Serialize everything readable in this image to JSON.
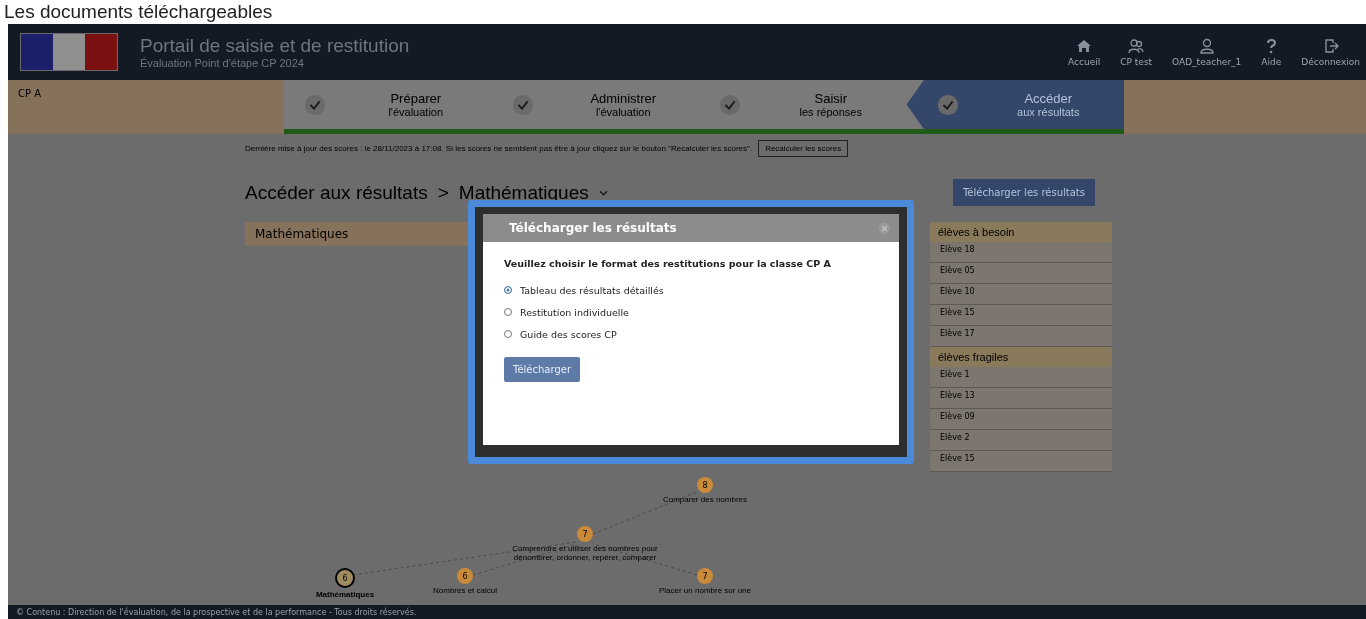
{
  "caption": "Les documents téléchargeables",
  "header": {
    "title": "Portail de saisie et de restitution",
    "subtitle": "Évaluation Point d'étape CP 2024",
    "nav": [
      {
        "label": "Accueil"
      },
      {
        "label": "CP test"
      },
      {
        "label": "OAD_teacher_1"
      },
      {
        "label": "Aide"
      },
      {
        "label": "Déconnexion"
      }
    ]
  },
  "class_name": "CP A",
  "steps": [
    {
      "title": "Préparer",
      "subtitle": "l'évaluation",
      "done": true,
      "selected": false
    },
    {
      "title": "Administrer",
      "subtitle": "l'évaluation",
      "done": true,
      "selected": false
    },
    {
      "title": "Saisir",
      "subtitle": "les réponses",
      "done": true,
      "selected": false
    },
    {
      "title": "Accéder",
      "subtitle": "aux résultats",
      "done": true,
      "selected": true
    }
  ],
  "update_notice": "Dernière mise à jour des scores : le 28/11/2023 à 17:08. Si les scores ne semblent pas être à jour cliquez sur le bouton \"Recalculer les scores\".",
  "recalc_button": "Recalculer les scores",
  "breadcrumb": {
    "root": "Accéder aux résultats",
    "separator": ">",
    "current": "Mathématiques"
  },
  "download_button": "Télécharger les résultats",
  "domain_panel": {
    "title": "Mathématiques",
    "nodes": [
      {
        "kind": "item",
        "score": "8",
        "label": "Comparer des nombres"
      },
      {
        "kind": "item",
        "score": "7",
        "label": "Comprendre et utiliser des nombres pour dénombrer, ordonner, repérer, comparer"
      },
      {
        "kind": "root",
        "score": "6",
        "label": "Mathématiques"
      },
      {
        "kind": "item",
        "score": "6",
        "label": "Nombres et calcul"
      },
      {
        "kind": "item",
        "score": "7",
        "label": "Placer un nombre sur une"
      }
    ]
  },
  "groups": [
    {
      "title": "élèves à besoin",
      "students": [
        "Elève 18",
        "Elève 05",
        "Elève 10",
        "Elève 15",
        "Elève 17"
      ]
    },
    {
      "title": "élèves fragiles",
      "students": [
        "Elève 1",
        "Elève 13",
        "Elève 09",
        "Elève 2",
        "Elève 15"
      ]
    }
  ],
  "modal": {
    "title": "Télécharger les résultats",
    "prompt": "Veuillez choisir le format des restitutions pour la classe CP A",
    "options": [
      {
        "label": "Tableau des résultats détaillés",
        "selected": true
      },
      {
        "label": "Restitution individuelle",
        "selected": false
      },
      {
        "label": "Guide des scores CP",
        "selected": false
      }
    ],
    "button": "Télécharger"
  },
  "footer": "© Contenu : Direction de l'évaluation, de la prospective et de la performance - Tous droits réservés."
}
